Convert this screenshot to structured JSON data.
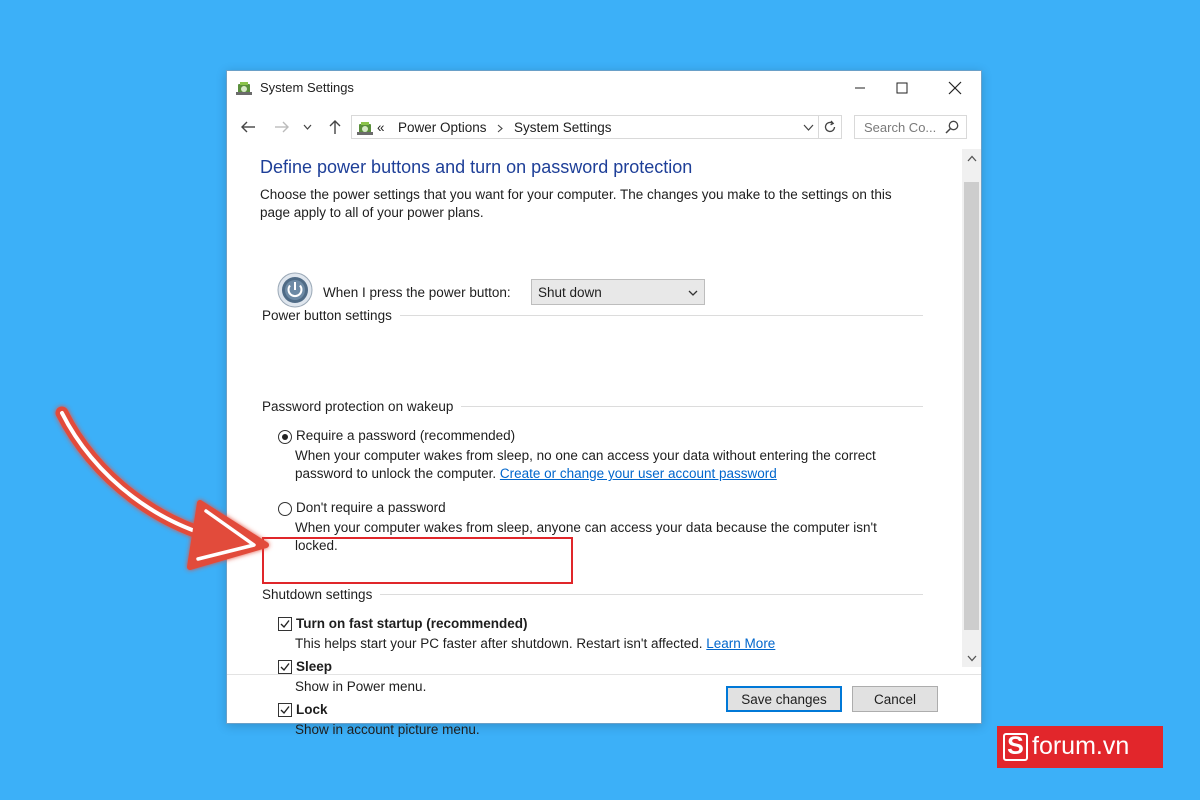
{
  "window": {
    "title": "System Settings"
  },
  "navigation": {
    "breadcrumb_prefix": "«",
    "breadcrumbs": [
      "Power Options",
      "System Settings"
    ],
    "search_placeholder": "Search Co..."
  },
  "page": {
    "heading": "Define power buttons and turn on password protection",
    "description": "Choose the power settings that you want for your computer. The changes you make to the settings on this page apply to all of your power plans."
  },
  "power_button": {
    "group_label": "Power button settings",
    "label": "When I press the power button:",
    "selected": "Shut down"
  },
  "password": {
    "group_label": "Password protection on wakeup",
    "options": [
      {
        "label": "Require a password (recommended)",
        "desc": "When your computer wakes from sleep, no one can access your data without entering the correct password to unlock the computer.",
        "link": "Create or change your user account password",
        "selected": true
      },
      {
        "label": "Don't require a password",
        "desc": "When your computer wakes from sleep, anyone can access your data because the computer isn't locked.",
        "selected": false
      }
    ]
  },
  "shutdown": {
    "group_label": "Shutdown settings",
    "items": [
      {
        "label": "Turn on fast startup (recommended)",
        "desc": "This helps start your PC faster after shutdown. Restart isn't affected.",
        "link": "Learn More",
        "checked": true
      },
      {
        "label": "Sleep",
        "desc": "Show in Power menu.",
        "checked": true
      },
      {
        "label": "Lock",
        "desc": "Show in account picture menu.",
        "checked": true
      }
    ]
  },
  "footer": {
    "save": "Save changes",
    "cancel": "Cancel"
  },
  "watermark": {
    "letter": "S",
    "text": "forum.vn"
  },
  "colors": {
    "background": "#3cb0f8",
    "heading": "#1e3f98",
    "link": "#0066cc",
    "highlight": "#e0262a",
    "badge": "#e2262b",
    "primary_button_border": "#0078d7"
  }
}
